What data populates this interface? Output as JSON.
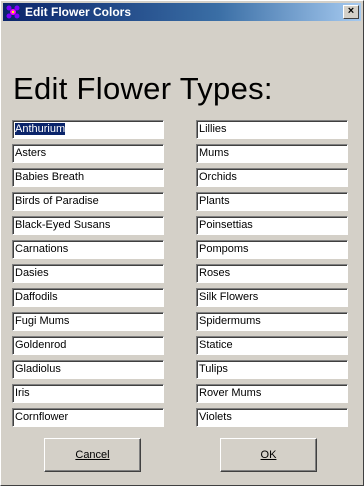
{
  "window": {
    "title": "Edit Flower Colors",
    "icon": "app-icon"
  },
  "heading": "Edit Flower Types:",
  "left_fields": [
    "Anthurium",
    "Asters",
    "Babies Breath",
    "Birds of Paradise",
    "Black-Eyed Susans",
    "Carnations",
    "Dasies",
    "Daffodils",
    "Fugi Mums",
    "Goldenrod",
    "Gladiolus",
    "Iris",
    "Cornflower"
  ],
  "right_fields": [
    "Lillies",
    "Mums",
    "Orchids",
    "Plants",
    "Poinsettias",
    "Pompoms",
    "Roses",
    "Silk Flowers",
    "Spidermums",
    "Statice",
    "Tulips",
    "Rover Mums",
    "Violets"
  ],
  "buttons": {
    "cancel": "Cancel",
    "ok": "OK"
  },
  "colors": {
    "title_start": "#0a246a",
    "title_end": "#a6caf0",
    "background": "#d4d0c8",
    "selection": "#0a246a"
  }
}
